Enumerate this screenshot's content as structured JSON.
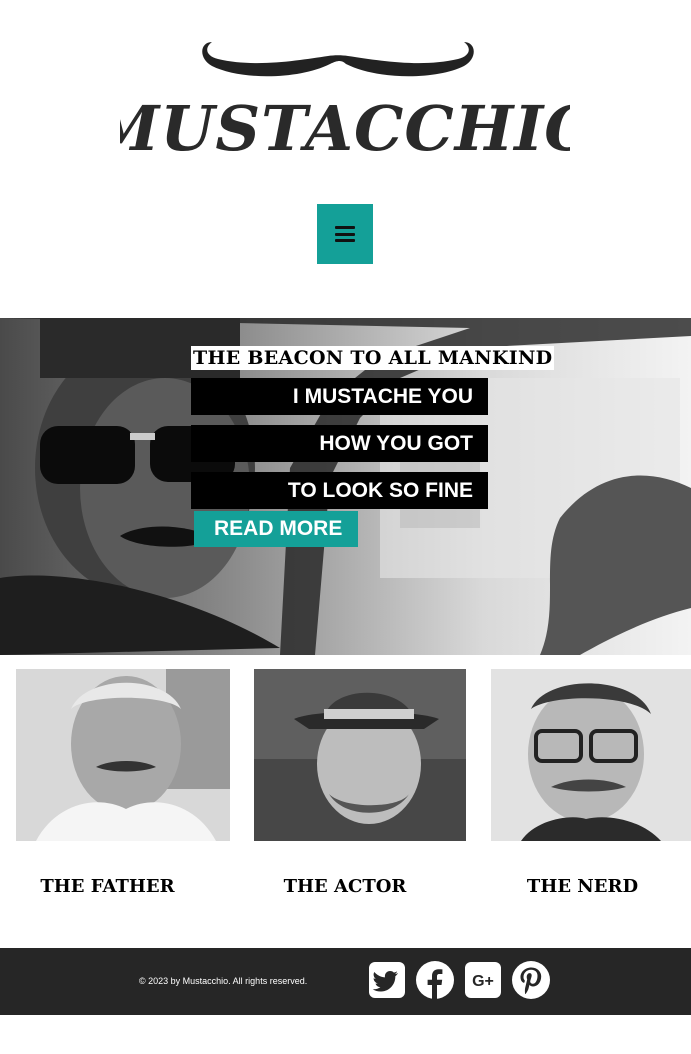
{
  "brand": {
    "name": "MUSTACCHIO"
  },
  "nav": {
    "menu_icon": "hamburger-menu-icon",
    "accent": "#14a098"
  },
  "hero": {
    "tagline": "THE BEACON TO ALL MANKIND",
    "lines": [
      "I MUSTACHE YOU",
      "HOW YOU GOT",
      "TO LOOK SO FINE"
    ],
    "cta_label": "READ MORE"
  },
  "cards": [
    {
      "title": "THE FATHER"
    },
    {
      "title": "THE ACTOR"
    },
    {
      "title": "THE NERD"
    }
  ],
  "footer": {
    "copyright": "© 2023 by Mustacchio. All rights reserved.",
    "social": [
      {
        "icon": "twitter-icon"
      },
      {
        "icon": "facebook-icon"
      },
      {
        "icon": "google-plus-icon",
        "text": "G+"
      },
      {
        "icon": "pinterest-icon"
      }
    ],
    "background": "#262626"
  }
}
